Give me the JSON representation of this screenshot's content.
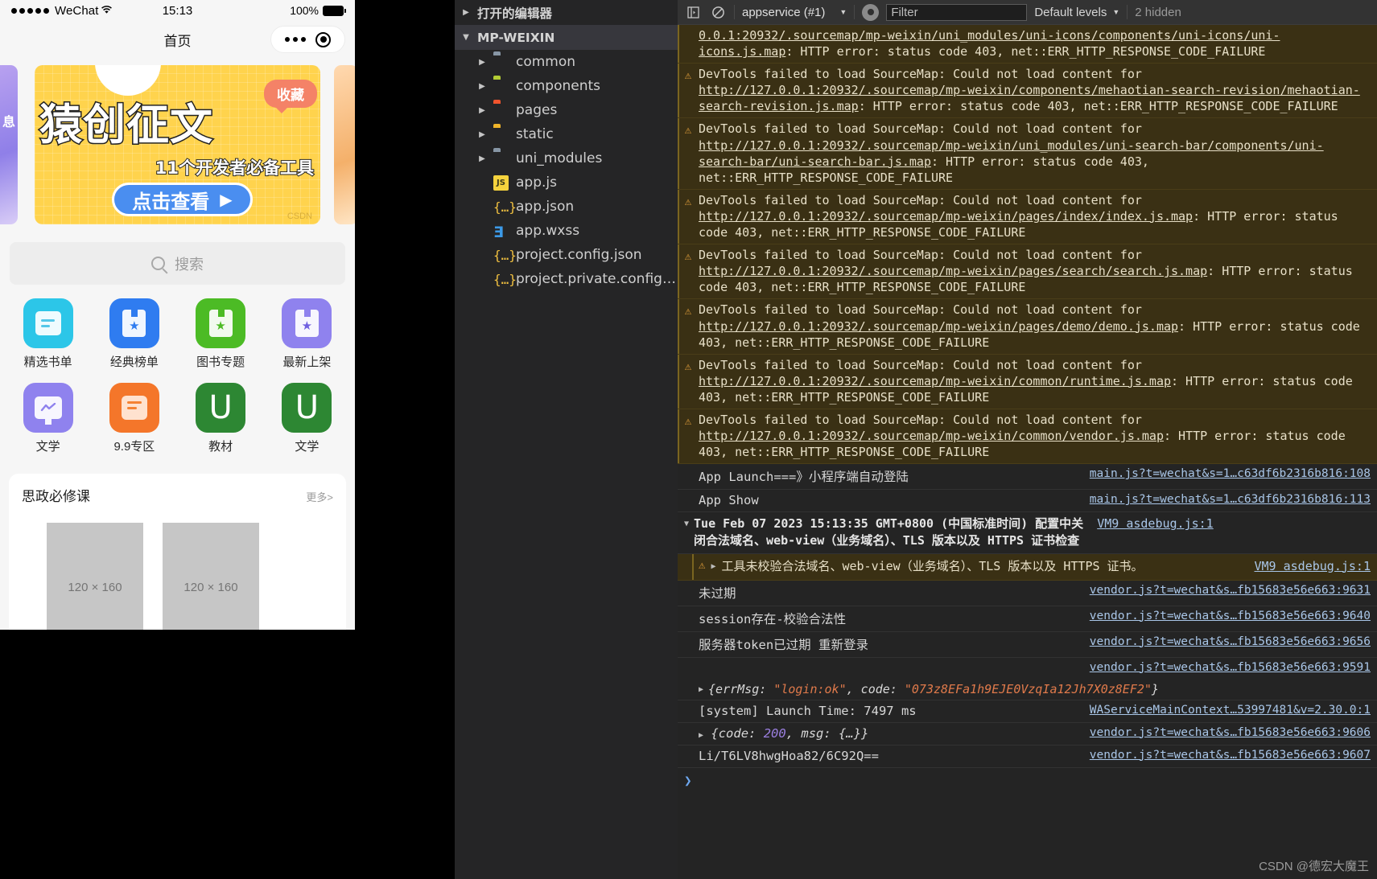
{
  "simulator": {
    "status": {
      "carrier": "WeChat",
      "time": "15:13",
      "battery": "100%"
    },
    "navbar": {
      "title": "首页"
    },
    "banner": {
      "title": "猿创征文",
      "subtitle": "11个开发者必备工具",
      "tag": "收藏",
      "button": "点击查看",
      "arrow": "▶",
      "watermark": "CSDN",
      "side_left_text": "息"
    },
    "search": {
      "placeholder": "搜索",
      "icon": "search-icon"
    },
    "grid": [
      {
        "label": "精选书单",
        "color": "#2cc6e8",
        "icon": "document-icon"
      },
      {
        "label": "经典榜单",
        "color": "#2f7cf0",
        "icon": "bookmark-star-icon"
      },
      {
        "label": "图书专题",
        "color": "#4cbb25",
        "icon": "bookmark-star-icon"
      },
      {
        "label": "最新上架",
        "color": "#8f82ee",
        "icon": "bookmark-star-icon"
      },
      {
        "label": "文学",
        "color": "#8f82ee",
        "icon": "monitor-chart-icon"
      },
      {
        "label": "9.9专区",
        "color": "#f4762a",
        "icon": "envelope-icon"
      },
      {
        "label": "教材",
        "color": "#2d8733",
        "icon": "u-letter-icon"
      },
      {
        "label": "文学",
        "color": "#2d8733",
        "icon": "u-letter-icon"
      }
    ],
    "card": {
      "title": "思政必修课",
      "more": "更多>",
      "placeholders": [
        "120 × 160",
        "120 × 160"
      ]
    }
  },
  "explorer": {
    "sections": [
      {
        "label": "打开的编辑器",
        "twisty": "▶",
        "active": false
      },
      {
        "label": "MP-WEIXIN",
        "twisty": "▼",
        "active": true
      }
    ],
    "files": [
      {
        "name": "common",
        "type": "folder",
        "twisty": "▶",
        "color": "#8796a5",
        "icon": "folder-icon"
      },
      {
        "name": "components",
        "type": "folder",
        "twisty": "▶",
        "color": "#b3cc34",
        "icon": "folder-components-icon"
      },
      {
        "name": "pages",
        "type": "folder",
        "twisty": "▶",
        "color": "#f0542d",
        "icon": "folder-pages-icon"
      },
      {
        "name": "static",
        "type": "folder",
        "twisty": "▶",
        "color": "#f0b429",
        "icon": "folder-static-icon"
      },
      {
        "name": "uni_modules",
        "type": "folder",
        "twisty": "▶",
        "color": "#8796a5",
        "icon": "folder-icon"
      },
      {
        "name": "app.js",
        "type": "js",
        "twisty": "",
        "badge": "JS",
        "icon": "javascript-file-icon"
      },
      {
        "name": "app.json",
        "type": "json",
        "twisty": "",
        "badge": "{…}",
        "icon": "json-file-icon"
      },
      {
        "name": "app.wxss",
        "type": "css",
        "twisty": "",
        "badge": "Ǝ",
        "icon": "css-file-icon"
      },
      {
        "name": "project.config.json",
        "type": "json",
        "twisty": "",
        "badge": "{…}",
        "icon": "json-file-icon"
      },
      {
        "name": "project.private.config.js...",
        "type": "json",
        "twisty": "",
        "badge": "{…}",
        "icon": "json-file-icon"
      }
    ]
  },
  "devtools": {
    "toolbar": {
      "sidebar_icon": "console-sidebar-icon",
      "clear_icon": "clear-console-icon",
      "context": "appservice (#1)",
      "context_chevron": "▼",
      "eye_icon": "live-expression-icon",
      "filter_placeholder": "Filter",
      "levels": "Default levels",
      "levels_chevron": "▼",
      "hidden": "2 hidden"
    },
    "messages": [
      {
        "kind": "warn",
        "clipped": true,
        "text_parts": [
          {
            "t": "link",
            "v": "0.0.1:20932/.sourcemap/mp-weixin/uni_modules/uni-icons/components/uni-icons/uni-icons.js.map"
          },
          {
            "t": "plain",
            "v": ": HTTP error: status code 403, net::ERR_HTTP_RESPONSE_CODE_FAILURE"
          }
        ]
      },
      {
        "kind": "warn",
        "text_parts": [
          {
            "t": "plain",
            "v": "DevTools failed to load SourceMap: Could not load content for "
          },
          {
            "t": "link",
            "v": "http://127.0.0.1:20932/.sourcemap/mp-weixin/components/mehaotian-search-revision/mehaotian-search-revision.js.map"
          },
          {
            "t": "plain",
            "v": ": HTTP error: status code 403, net::ERR_HTTP_RESPONSE_CODE_FAILURE"
          }
        ]
      },
      {
        "kind": "warn",
        "text_parts": [
          {
            "t": "plain",
            "v": "DevTools failed to load SourceMap: Could not load content for "
          },
          {
            "t": "link",
            "v": "http://127.0.0.1:20932/.sourcemap/mp-weixin/uni_modules/uni-search-bar/components/uni-search-bar/uni-search-bar.js.map"
          },
          {
            "t": "plain",
            "v": ": HTTP error: status code 403, net::ERR_HTTP_RESPONSE_CODE_FAILURE"
          }
        ]
      },
      {
        "kind": "warn",
        "text_parts": [
          {
            "t": "plain",
            "v": "DevTools failed to load SourceMap: Could not load content for "
          },
          {
            "t": "link",
            "v": "http://127.0.0.1:20932/.sourcemap/mp-weixin/pages/index/index.js.map"
          },
          {
            "t": "plain",
            "v": ": HTTP error: status code 403, net::ERR_HTTP_RESPONSE_CODE_FAILURE"
          }
        ]
      },
      {
        "kind": "warn",
        "text_parts": [
          {
            "t": "plain",
            "v": "DevTools failed to load SourceMap: Could not load content for "
          },
          {
            "t": "link",
            "v": "http://127.0.0.1:20932/.sourcemap/mp-weixin/pages/search/search.js.map"
          },
          {
            "t": "plain",
            "v": ": HTTP error: status code 403, net::ERR_HTTP_RESPONSE_CODE_FAILURE"
          }
        ]
      },
      {
        "kind": "warn",
        "text_parts": [
          {
            "t": "plain",
            "v": "DevTools failed to load SourceMap: Could not load content for "
          },
          {
            "t": "link",
            "v": "http://127.0.0.1:20932/.sourcemap/mp-weixin/pages/demo/demo.js.map"
          },
          {
            "t": "plain",
            "v": ": HTTP error: status code 403, net::ERR_HTTP_RESPONSE_CODE_FAILURE"
          }
        ]
      },
      {
        "kind": "warn",
        "text_parts": [
          {
            "t": "plain",
            "v": "DevTools failed to load SourceMap: Could not load content for "
          },
          {
            "t": "link",
            "v": "http://127.0.0.1:20932/.sourcemap/mp-weixin/common/runtime.js.map"
          },
          {
            "t": "plain",
            "v": ": HTTP error: status code 403, net::ERR_HTTP_RESPONSE_CODE_FAILURE"
          }
        ]
      },
      {
        "kind": "warn",
        "text_parts": [
          {
            "t": "plain",
            "v": "DevTools failed to load SourceMap: Could not load content for "
          },
          {
            "t": "link",
            "v": "http://127.0.0.1:20932/.sourcemap/mp-weixin/common/vendor.js.map"
          },
          {
            "t": "plain",
            "v": ": HTTP error: status code 403, net::ERR_HTTP_RESPONSE_CODE_FAILURE"
          }
        ]
      }
    ],
    "logs_top": [
      {
        "text": "App Launch===》小程序端自动登陆",
        "source": "main.js?t=wechat&s=1…c63df6b2316b816:108"
      },
      {
        "text": "App Show",
        "source": "main.js?t=wechat&s=1…c63df6b2316b816:113"
      }
    ],
    "group": {
      "twisty": "▼",
      "line1": "Tue Feb 07 2023 15:13:35 GMT+0800 (中国标准时间) 配置中关",
      "line2": "闭合法域名、web-view（业务域名）、TLS 版本以及 HTTPS 证书检查",
      "source": "VM9 asdebug.js:1"
    },
    "nested_warning": {
      "twisty": "▶",
      "text": "工具未校验合法域名、web-view（业务域名）、TLS 版本以及 HTTPS 证书。",
      "source": "VM9 asdebug.js:1"
    },
    "logs_bottom": [
      {
        "text": "未过期",
        "source": "vendor.js?t=wechat&s…fb15683e56e663:9631"
      },
      {
        "text": "session存在-校验合法性",
        "source": "vendor.js?t=wechat&s…fb15683e56e663:9640"
      },
      {
        "text": "服务器token已过期 重新登录",
        "source": "vendor.js?t=wechat&s…fb15683e56e663:9656"
      },
      {
        "text": "",
        "source": "vendor.js?t=wechat&s…fb15683e56e663:9591"
      }
    ],
    "obj_login": {
      "twisty": "▶",
      "prefix": "{errMsg: ",
      "val1": "\"login:ok\"",
      "mid": ", code: ",
      "val2": "\"073z8EFa1h9EJE0VzqIa12Jh7X0z8EF2\"",
      "suffix": "}"
    },
    "log_launch": {
      "text": "[system] Launch Time: 7497 ms",
      "source": "WAServiceMainContext…53997481&v=2.30.0:1"
    },
    "obj_code": {
      "twisty": "▶",
      "prefix": "{code: ",
      "num": "200",
      "suffix": ", msg: {…}}",
      "source": "vendor.js?t=wechat&s…fb15683e56e663:9606"
    },
    "log_token": {
      "text": "Li/T6LV8hwgHoa82/6C92Q==",
      "source": "vendor.js?t=wechat&s…fb15683e56e663:9607"
    },
    "prompt": "❯",
    "watermark": "CSDN @德宏大魔王"
  }
}
